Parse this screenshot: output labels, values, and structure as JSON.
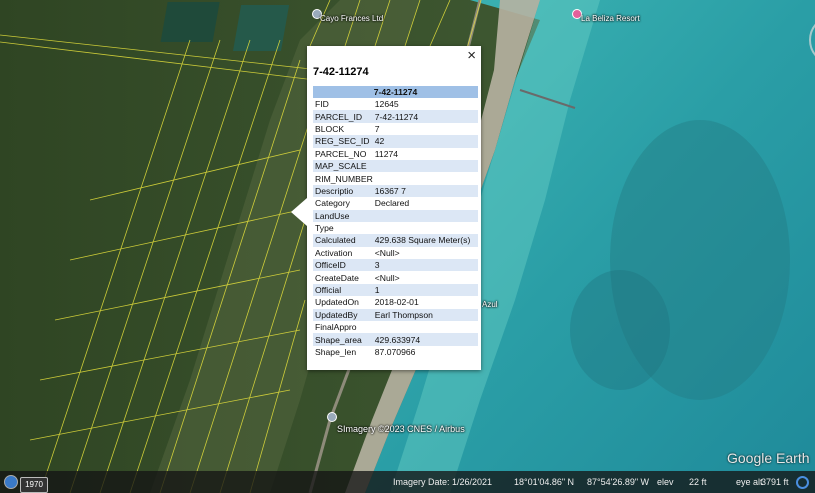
{
  "places": {
    "cayo": "Cayo Frances Ltd",
    "resort": "La Beliza Resort",
    "azul": "Azul",
    "bottom_label": "SImagery ©2023 CNES / Airbus"
  },
  "popup": {
    "title": "7-42-11274",
    "table_header": "7-42-11274",
    "close": "×",
    "rows": [
      {
        "k": "FID",
        "v": "12645"
      },
      {
        "k": "PARCEL_ID",
        "v": "7-42-11274"
      },
      {
        "k": "BLOCK",
        "v": "7"
      },
      {
        "k": "REG_SEC_ID",
        "v": "42"
      },
      {
        "k": "PARCEL_NO",
        "v": "11274"
      },
      {
        "k": "MAP_SCALE",
        "v": ""
      },
      {
        "k": "RIM_NUMBER",
        "v": ""
      },
      {
        "k": "Descriptio",
        "v": "16367 7"
      },
      {
        "k": "Category",
        "v": "Declared"
      },
      {
        "k": "LandUse",
        "v": ""
      },
      {
        "k": "Type",
        "v": ""
      },
      {
        "k": "Calculated",
        "v": "429.638 Square Meter(s)"
      },
      {
        "k": "Activation",
        "v": "<Null>"
      },
      {
        "k": "OfficeID",
        "v": "3"
      },
      {
        "k": "CreateDate",
        "v": "<Null>"
      },
      {
        "k": "Official",
        "v": "1"
      },
      {
        "k": "UpdatedOn",
        "v": "2018-02-01"
      },
      {
        "k": "UpdatedBy",
        "v": "Earl Thompson"
      },
      {
        "k": "FinalAppro",
        "v": ""
      },
      {
        "k": "Shape_area",
        "v": "429.633974"
      },
      {
        "k": "Shape_len",
        "v": "87.070966"
      }
    ]
  },
  "nav": {
    "north": "N"
  },
  "brand": "Google Earth",
  "status": {
    "year": "1970",
    "imagery_date": "Imagery Date: 1/26/2021",
    "lat": "18°01'04.86\" N",
    "lon": "87°54'26.89\" W",
    "elev_label": "elev",
    "elev": "22 ft",
    "eye_label": "eye alt",
    "eye": "3791 ft"
  }
}
